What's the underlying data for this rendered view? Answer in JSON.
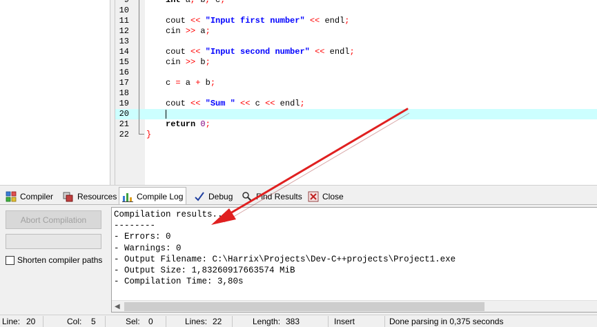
{
  "editor": {
    "lines": [
      {
        "n": "9",
        "code": "int a, b, c;",
        "partial": true
      },
      {
        "n": "10",
        "code": ""
      },
      {
        "n": "11",
        "code": "cout << \"Input first number\" << endl;"
      },
      {
        "n": "12",
        "code": "cin >> a;"
      },
      {
        "n": "13",
        "code": ""
      },
      {
        "n": "14",
        "code": "cout << \"Input second number\" << endl;"
      },
      {
        "n": "15",
        "code": "cin >> b;"
      },
      {
        "n": "16",
        "code": ""
      },
      {
        "n": "17",
        "code": "c = a + b;"
      },
      {
        "n": "18",
        "code": ""
      },
      {
        "n": "19",
        "code": "cout << \"Sum \" << c << endl;"
      },
      {
        "n": "20",
        "code": "",
        "current": true
      },
      {
        "n": "21",
        "code": "return 0;"
      },
      {
        "n": "22",
        "code": "}"
      }
    ]
  },
  "tabs": [
    {
      "label": "Compiler",
      "icon": "compiler-grid-icon"
    },
    {
      "label": "Resources",
      "icon": "resources-icon"
    },
    {
      "label": "Compile Log",
      "icon": "bar-chart-icon",
      "active": true
    },
    {
      "label": "Debug",
      "icon": "checkmark-icon"
    },
    {
      "label": "Find Results",
      "icon": "find-results-icon"
    },
    {
      "label": "Close",
      "icon": "close-icon"
    }
  ],
  "compile": {
    "abort_label": "Abort Compilation",
    "shorten_label": "Shorten compiler paths",
    "shorten_checked": false,
    "log": [
      "Compilation results...",
      "--------",
      "- Errors: 0",
      "- Warnings: 0",
      "- Output Filename: C:\\Harrix\\Projects\\Dev-C++projects\\Project1.exe",
      "- Output Size: 1,83260917663574 MiB",
      "- Compilation Time: 3,80s"
    ]
  },
  "status": {
    "line_label": "Line:",
    "line_value": "20",
    "col_label": "Col:",
    "col_value": "5",
    "sel_label": "Sel:",
    "sel_value": "0",
    "lines_label": "Lines:",
    "lines_value": "22",
    "length_label": "Length:",
    "length_value": "383",
    "mode": "Insert",
    "message": "Done parsing in 0,375 seconds"
  },
  "colors": {
    "current_line": "#ccffff",
    "string": "#0000ff",
    "operator": "#ff0000",
    "annotation_arrow": "#e02020"
  }
}
